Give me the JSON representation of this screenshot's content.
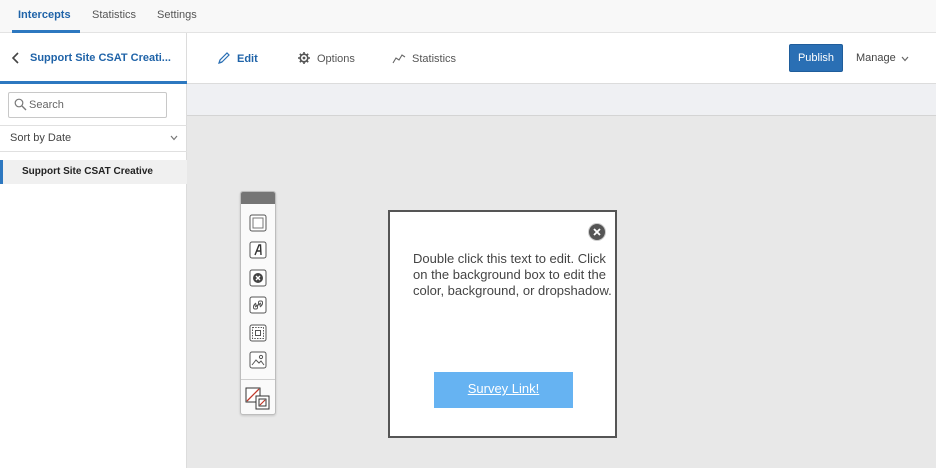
{
  "top_nav": {
    "tabs": [
      {
        "label": "Intercepts",
        "active": true
      },
      {
        "label": "Statistics",
        "active": false
      },
      {
        "label": "Settings",
        "active": false
      }
    ]
  },
  "sidebar": {
    "title": "Support Site CSAT Creati...",
    "search_placeholder": "Search",
    "sort_label": "Sort by Date",
    "items": [
      {
        "label": "Support Site CSAT Creative",
        "selected": true
      }
    ]
  },
  "toolbar": {
    "edit_label": "Edit",
    "options_label": "Options",
    "statistics_label": "Statistics",
    "publish_label": "Publish",
    "manage_label": "Manage"
  },
  "palette": {
    "tools": [
      {
        "icon": "rectangle-icon"
      },
      {
        "icon": "text-icon"
      },
      {
        "icon": "close-button-icon"
      },
      {
        "icon": "link-icon"
      },
      {
        "icon": "embed-target-icon"
      },
      {
        "icon": "image-icon"
      },
      {
        "icon": "color-swatch-icon"
      }
    ]
  },
  "creative": {
    "body_text": "Double click this text to edit. Click on the background box to edit the color, background, or dropshadow.",
    "button_label": "Survey Link!"
  },
  "colors": {
    "accent": "#2a6fb4",
    "link_button": "#66b3f2",
    "canvas_bg": "#e8e8e8"
  }
}
